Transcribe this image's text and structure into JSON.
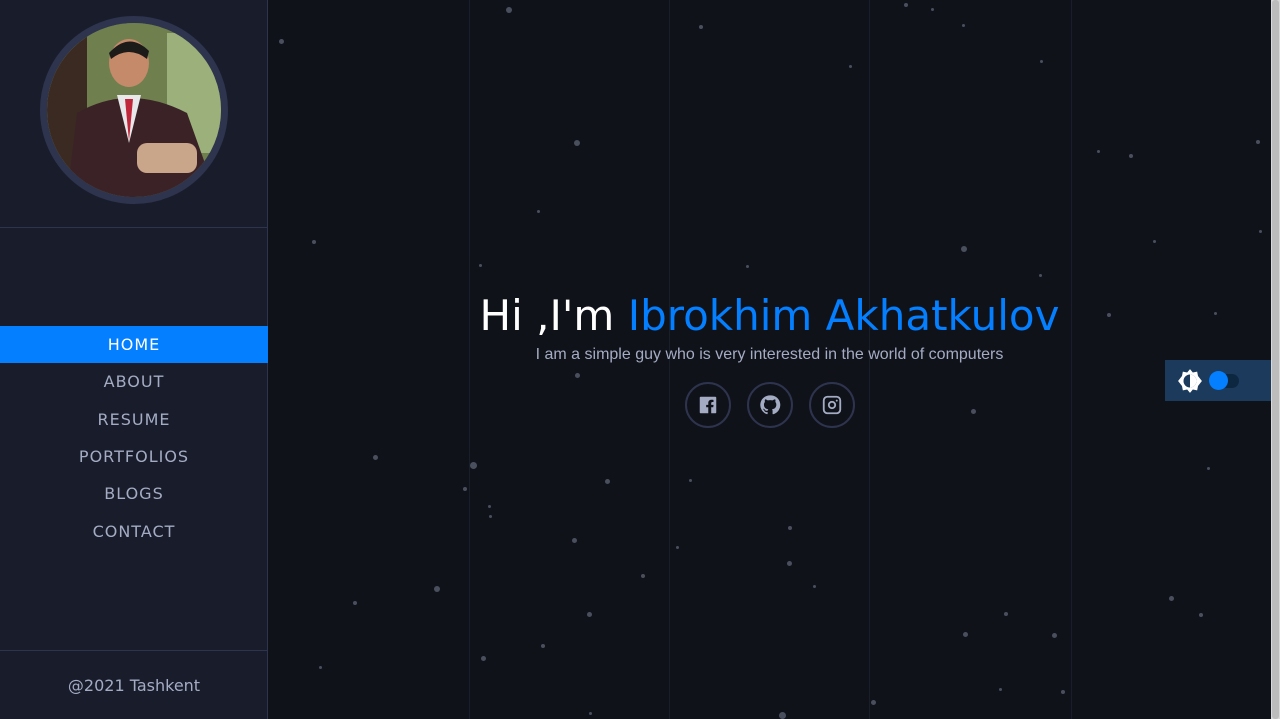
{
  "sidebar": {
    "avatar_alt": "Profile photo",
    "nav": [
      {
        "label": "HOME",
        "active": true
      },
      {
        "label": "ABOUT"
      },
      {
        "label": "RESUME"
      },
      {
        "label": "PORTFOLIOS"
      },
      {
        "label": "BLOGS"
      },
      {
        "label": "CONTACT"
      }
    ],
    "footer": "@2021 Tashkent"
  },
  "hero": {
    "greeting": "Hi ,I'm",
    "name": "Ibrokhim Akhatkulov",
    "subtitle": "I am a simple guy who is very interested in the world of computers"
  },
  "socials": [
    {
      "icon": "facebook-icon"
    },
    {
      "icon": "github-icon"
    },
    {
      "icon": "instagram-icon"
    }
  ],
  "theme_toggle": {
    "icon": "brightness-icon",
    "state": "dark"
  },
  "colors": {
    "accent": "#037fff",
    "sidebar_bg": "#191d2b",
    "main_bg": "#10121a",
    "text_muted": "#a4acc4"
  }
}
